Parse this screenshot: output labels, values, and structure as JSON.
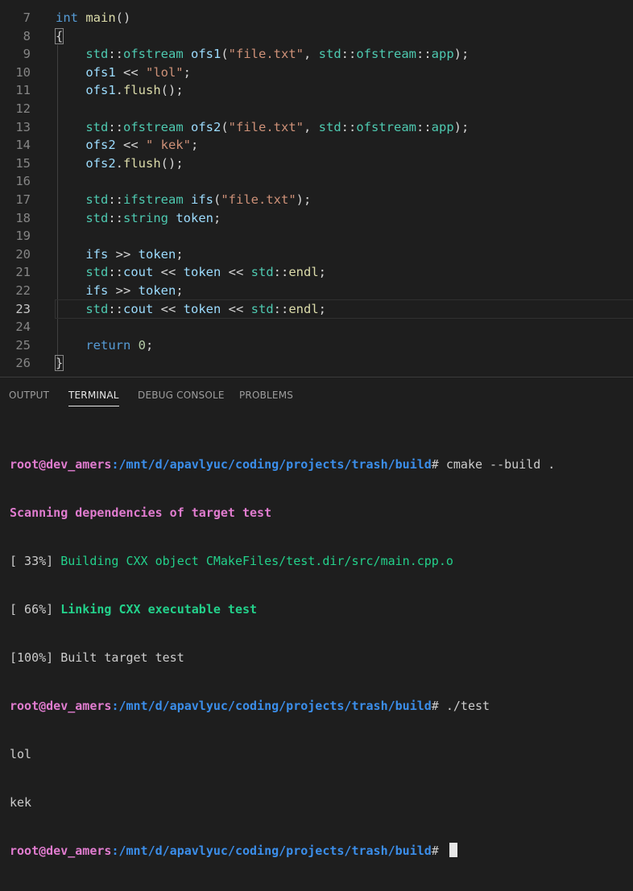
{
  "editor": {
    "top_partial_line": "6",
    "lines": [
      {
        "n": "7",
        "tokens": [
          [
            "kw",
            "int"
          ],
          [
            "pun",
            " "
          ],
          [
            "fn",
            "main"
          ],
          [
            "pun",
            "()"
          ]
        ]
      },
      {
        "n": "8",
        "tokens": [
          [
            "pun",
            "{"
          ]
        ]
      },
      {
        "n": "9",
        "tokens": [
          [
            "pun",
            "    "
          ],
          [
            "ns",
            "std"
          ],
          [
            "pun",
            "::"
          ],
          [
            "ty",
            "ofstream"
          ],
          [
            "pun",
            " "
          ],
          [
            "var",
            "ofs1"
          ],
          [
            "pun",
            "("
          ],
          [
            "str",
            "\"file.txt\""
          ],
          [
            "pun",
            ", "
          ],
          [
            "ns",
            "std"
          ],
          [
            "pun",
            "::"
          ],
          [
            "ty",
            "ofstream"
          ],
          [
            "pun",
            "::"
          ],
          [
            "ns",
            "app"
          ],
          [
            "pun",
            ");"
          ]
        ]
      },
      {
        "n": "10",
        "tokens": [
          [
            "pun",
            "    "
          ],
          [
            "var",
            "ofs1"
          ],
          [
            "op",
            " << "
          ],
          [
            "str",
            "\"lol\""
          ],
          [
            "pun",
            ";"
          ]
        ]
      },
      {
        "n": "11",
        "tokens": [
          [
            "pun",
            "    "
          ],
          [
            "var",
            "ofs1"
          ],
          [
            "pun",
            "."
          ],
          [
            "fn",
            "flush"
          ],
          [
            "pun",
            "();"
          ]
        ]
      },
      {
        "n": "12",
        "tokens": []
      },
      {
        "n": "13",
        "tokens": [
          [
            "pun",
            "    "
          ],
          [
            "ns",
            "std"
          ],
          [
            "pun",
            "::"
          ],
          [
            "ty",
            "ofstream"
          ],
          [
            "pun",
            " "
          ],
          [
            "var",
            "ofs2"
          ],
          [
            "pun",
            "("
          ],
          [
            "str",
            "\"file.txt\""
          ],
          [
            "pun",
            ", "
          ],
          [
            "ns",
            "std"
          ],
          [
            "pun",
            "::"
          ],
          [
            "ty",
            "ofstream"
          ],
          [
            "pun",
            "::"
          ],
          [
            "ns",
            "app"
          ],
          [
            "pun",
            ");"
          ]
        ]
      },
      {
        "n": "14",
        "tokens": [
          [
            "pun",
            "    "
          ],
          [
            "var",
            "ofs2"
          ],
          [
            "op",
            " << "
          ],
          [
            "str",
            "\" kek\""
          ],
          [
            "pun",
            ";"
          ]
        ]
      },
      {
        "n": "15",
        "tokens": [
          [
            "pun",
            "    "
          ],
          [
            "var",
            "ofs2"
          ],
          [
            "pun",
            "."
          ],
          [
            "fn",
            "flush"
          ],
          [
            "pun",
            "();"
          ]
        ]
      },
      {
        "n": "16",
        "tokens": []
      },
      {
        "n": "17",
        "tokens": [
          [
            "pun",
            "    "
          ],
          [
            "ns",
            "std"
          ],
          [
            "pun",
            "::"
          ],
          [
            "ty",
            "ifstream"
          ],
          [
            "pun",
            " "
          ],
          [
            "var",
            "ifs"
          ],
          [
            "pun",
            "("
          ],
          [
            "str",
            "\"file.txt\""
          ],
          [
            "pun",
            ");"
          ]
        ]
      },
      {
        "n": "18",
        "tokens": [
          [
            "pun",
            "    "
          ],
          [
            "ns",
            "std"
          ],
          [
            "pun",
            "::"
          ],
          [
            "ty",
            "string"
          ],
          [
            "pun",
            " "
          ],
          [
            "var",
            "token"
          ],
          [
            "pun",
            ";"
          ]
        ]
      },
      {
        "n": "19",
        "tokens": []
      },
      {
        "n": "20",
        "tokens": [
          [
            "pun",
            "    "
          ],
          [
            "var",
            "ifs"
          ],
          [
            "op",
            " >> "
          ],
          [
            "var",
            "token"
          ],
          [
            "pun",
            ";"
          ]
        ]
      },
      {
        "n": "21",
        "tokens": [
          [
            "pun",
            "    "
          ],
          [
            "ns",
            "std"
          ],
          [
            "pun",
            "::"
          ],
          [
            "var",
            "cout"
          ],
          [
            "op",
            " << "
          ],
          [
            "var",
            "token"
          ],
          [
            "op",
            " << "
          ],
          [
            "ns",
            "std"
          ],
          [
            "pun",
            "::"
          ],
          [
            "fn",
            "endl"
          ],
          [
            "pun",
            ";"
          ]
        ]
      },
      {
        "n": "22",
        "tokens": [
          [
            "pun",
            "    "
          ],
          [
            "var",
            "ifs"
          ],
          [
            "op",
            " >> "
          ],
          [
            "var",
            "token"
          ],
          [
            "pun",
            ";"
          ]
        ]
      },
      {
        "n": "23",
        "tokens": [
          [
            "pun",
            "    "
          ],
          [
            "ns",
            "std"
          ],
          [
            "pun",
            "::"
          ],
          [
            "var",
            "cout"
          ],
          [
            "op",
            " << "
          ],
          [
            "var",
            "token"
          ],
          [
            "op",
            " << "
          ],
          [
            "ns",
            "std"
          ],
          [
            "pun",
            "::"
          ],
          [
            "fn",
            "endl"
          ],
          [
            "pun",
            ";"
          ]
        ]
      },
      {
        "n": "24",
        "tokens": []
      },
      {
        "n": "25",
        "tokens": [
          [
            "pun",
            "    "
          ],
          [
            "kw",
            "return"
          ],
          [
            "pun",
            " "
          ],
          [
            "num",
            "0"
          ],
          [
            "pun",
            ";"
          ]
        ]
      },
      {
        "n": "26",
        "tokens": [
          [
            "pun",
            "}"
          ]
        ]
      }
    ],
    "current_line": "23"
  },
  "panel": {
    "tabs": [
      {
        "label": "OUTPUT",
        "active": false
      },
      {
        "label": "TERMINAL",
        "active": true
      },
      {
        "label": "DEBUG CONSOLE",
        "active": false
      },
      {
        "label": "PROBLEMS",
        "active": false
      }
    ]
  },
  "terminal": {
    "prompt_user": "root@dev_amers",
    "prompt_path": ":/mnt/d/apavlyuc/coding/projects/trash/build",
    "prompt_end": "# ",
    "cmd1": "cmake --build .",
    "scan": "Scanning dependencies of target test",
    "b1_pct": "[ 33%] ",
    "b1_text": "Building CXX object CMakeFiles/test.dir/src/main.cpp.o",
    "b2_pct": "[ 66%] ",
    "b2_text": "Linking CXX executable test",
    "b3": "[100%] Built target test",
    "cmd2": "./test",
    "out1": "lol",
    "out2": "kek"
  }
}
